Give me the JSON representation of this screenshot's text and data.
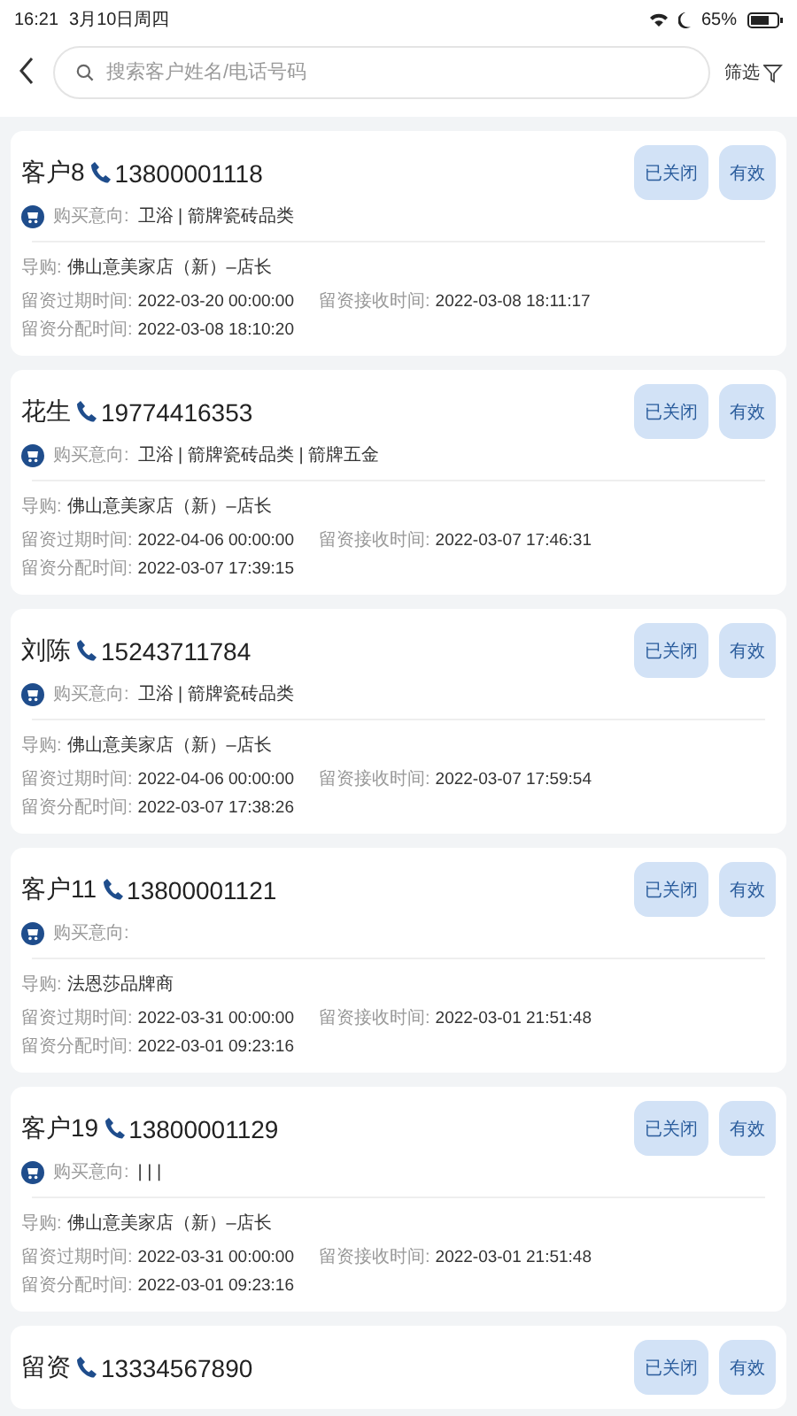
{
  "status_bar": {
    "time": "16:21",
    "date": "3月10日周四",
    "battery": "65%"
  },
  "header": {
    "search": {
      "placeholder": "搜索客户姓名/电话号码"
    },
    "filter_label": "筛选"
  },
  "cards": [
    {
      "name": "客户8",
      "phone": "13800001118",
      "buttons": [
        "已关闭",
        "有效"
      ],
      "intent_label": "购买意向:",
      "intent": "卫浴 | 箭牌瓷砖品类",
      "guide_label": "导购:",
      "guide": "佛山意美家店（新）–店长",
      "times": [
        {
          "label": "留资过期时间:",
          "value": "2022-03-20 00:00:00"
        },
        {
          "label": "留资接收时间:",
          "value": "2022-03-08 18:11:17"
        },
        {
          "label": "留资分配时间:",
          "value": "2022-03-08 18:10:20"
        }
      ]
    },
    {
      "name": "花生",
      "phone": "19774416353",
      "buttons": [
        "已关闭",
        "有效"
      ],
      "intent_label": "购买意向:",
      "intent": "卫浴 | 箭牌瓷砖品类 | 箭牌五金",
      "guide_label": "导购:",
      "guide": "佛山意美家店（新）–店长",
      "times": [
        {
          "label": "留资过期时间:",
          "value": "2022-04-06 00:00:00"
        },
        {
          "label": "留资接收时间:",
          "value": "2022-03-07 17:46:31"
        },
        {
          "label": "留资分配时间:",
          "value": "2022-03-07 17:39:15"
        }
      ]
    },
    {
      "name": "刘陈",
      "phone": "15243711784",
      "buttons": [
        "已关闭",
        "有效"
      ],
      "intent_label": "购买意向:",
      "intent": "卫浴 | 箭牌瓷砖品类",
      "guide_label": "导购:",
      "guide": "佛山意美家店（新）–店长",
      "times": [
        {
          "label": "留资过期时间:",
          "value": "2022-04-06 00:00:00"
        },
        {
          "label": "留资接收时间:",
          "value": "2022-03-07 17:59:54"
        },
        {
          "label": "留资分配时间:",
          "value": "2022-03-07 17:38:26"
        }
      ]
    },
    {
      "name": "客户11",
      "phone": "13800001121",
      "buttons": [
        "已关闭",
        "有效"
      ],
      "intent_label": "购买意向:",
      "guide_label": "导购:",
      "guide": "法恩莎品牌商",
      "times": [
        {
          "label": "留资过期时间:",
          "value": "2022-03-31 00:00:00"
        },
        {
          "label": "留资接收时间:",
          "value": "2022-03-01 21:51:48"
        },
        {
          "label": "留资分配时间:",
          "value": "2022-03-01 09:23:16"
        }
      ]
    },
    {
      "name": "客户19",
      "phone": "13800001129",
      "buttons": [
        "已关闭",
        "有效"
      ],
      "intent_label": "购买意向:",
      "intent": "| | |",
      "guide_label": "导购:",
      "guide": "佛山意美家店（新）–店长",
      "times": [
        {
          "label": "留资过期时间:",
          "value": "2022-03-31 00:00:00"
        },
        {
          "label": "留资接收时间:",
          "value": "2022-03-01 21:51:48"
        },
        {
          "label": "留资分配时间:",
          "value": "2022-03-01 09:23:16"
        }
      ]
    },
    {
      "name": "留资",
      "phone": "13334567890",
      "buttons": [
        "已关闭",
        "有效"
      ]
    }
  ]
}
